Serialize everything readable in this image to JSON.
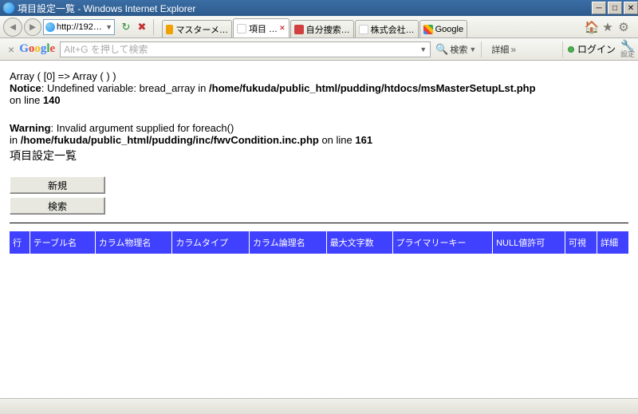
{
  "window": {
    "title": "項目設定一覧 - Windows Internet Explorer"
  },
  "nav": {
    "address": "http://192…"
  },
  "tabs": [
    {
      "label": "マスターメ…"
    },
    {
      "label": "項目 …",
      "active": true
    },
    {
      "label": "自分捜索…"
    },
    {
      "label": "株式会社…"
    },
    {
      "label": "Google"
    }
  ],
  "google_toolbar": {
    "search_placeholder": "Alt+G を押して検索",
    "search_btn": "検索",
    "detail_btn": "詳細",
    "login": "ログイン",
    "settings": "設定"
  },
  "errors": {
    "array_line": "Array ( [0] => Array ( ) )",
    "notice_label": "Notice",
    "notice_msg": ": Undefined variable: bread_array in ",
    "notice_file": "/home/fukuda/public_html/pudding/htdocs/msMasterSetupLst.php",
    "online": " on line ",
    "notice_line": "140",
    "warning_label": "Warning",
    "warning_msg": ": Invalid argument supplied for foreach()",
    "warning_in": "in ",
    "warning_file": "/home/fukuda/public_html/pudding/inc/fwvCondition.inc.php",
    "warning_line": "161"
  },
  "page": {
    "title": "項目設定一覧",
    "new_btn": "新規",
    "search_btn": "検索"
  },
  "columns": [
    "行",
    "テーブル名",
    "カラム物理名",
    "カラムタイプ",
    "カラム論理名",
    "最大文字数",
    "プライマリーキー",
    "NULL値許可",
    "可視",
    "詳細"
  ]
}
